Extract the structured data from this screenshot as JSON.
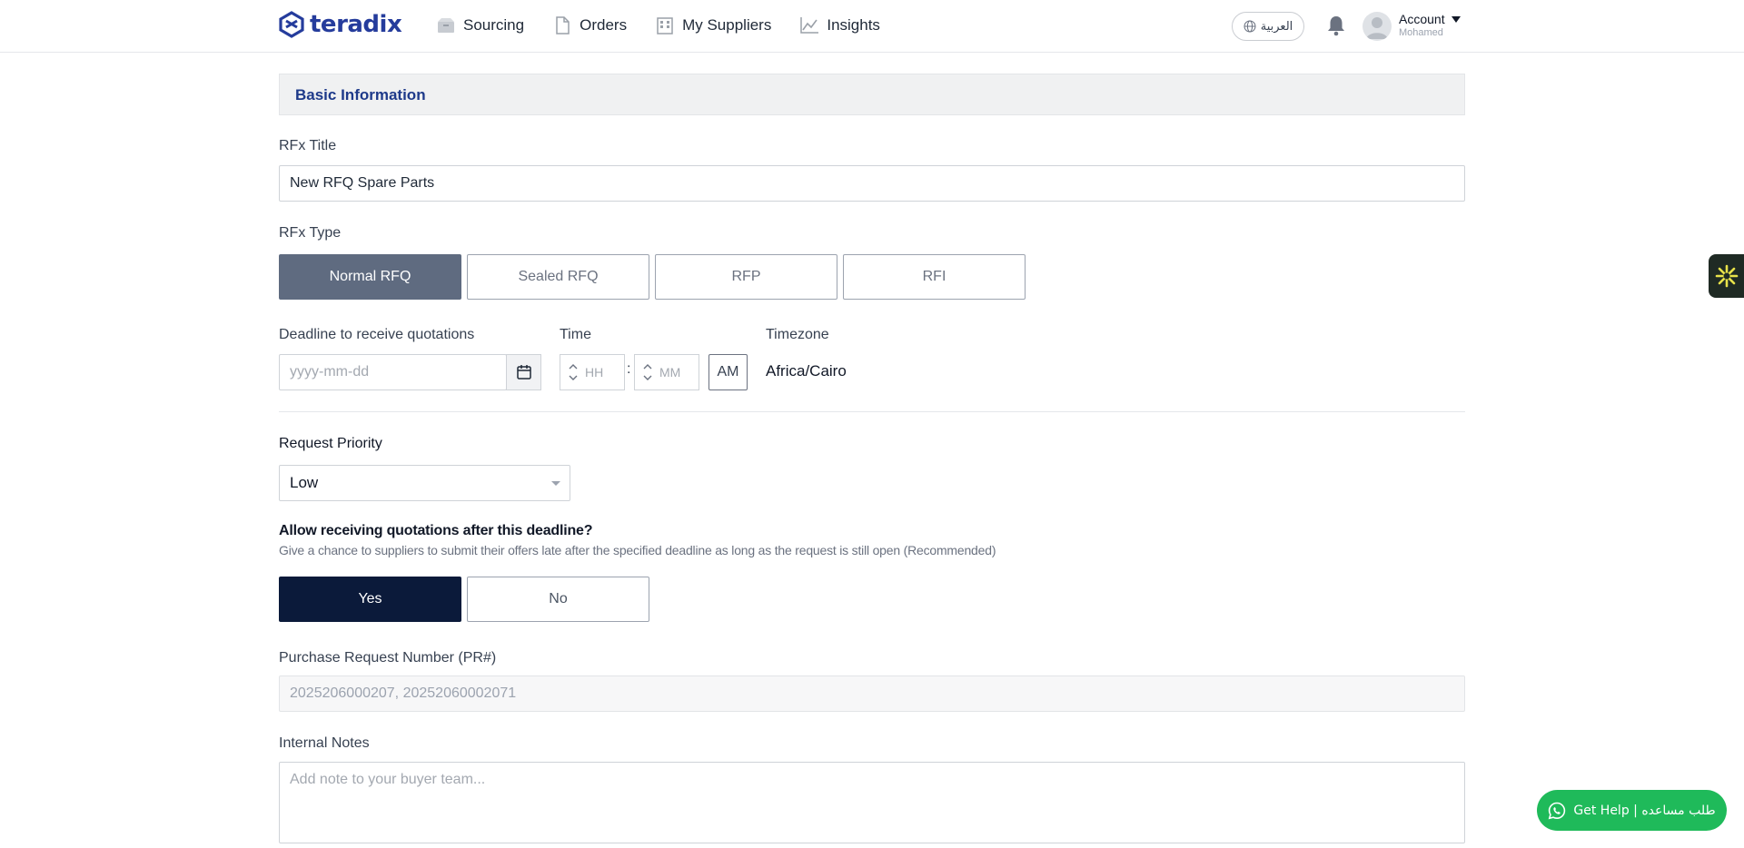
{
  "header": {
    "brand": "teradix",
    "nav": [
      {
        "label": "Sourcing",
        "icon": "box-icon"
      },
      {
        "label": "Orders",
        "icon": "document-icon"
      },
      {
        "label": "My Suppliers",
        "icon": "building-icon"
      },
      {
        "label": "Insights",
        "icon": "chart-icon"
      }
    ],
    "language": "العربية",
    "account_label": "Account",
    "account_user": "Mohamed"
  },
  "section": {
    "title": "Basic Information"
  },
  "form": {
    "rfx_title_label": "RFx Title",
    "rfx_title_value": "New RFQ Spare Parts",
    "rfx_type_label": "RFx Type",
    "rfx_types": [
      "Normal RFQ",
      "Sealed RFQ",
      "RFP",
      "RFI"
    ],
    "rfx_type_selected": "Normal RFQ",
    "deadline_label": "Deadline to receive quotations",
    "deadline_placeholder": "yyyy-mm-dd",
    "time_label": "Time",
    "hour_placeholder": "HH",
    "minute_placeholder": "MM",
    "time_separator": ":",
    "ampm": "AM",
    "timezone_label": "Timezone",
    "timezone_value": "Africa/Cairo",
    "priority_label": "Request Priority",
    "priority_value": "Low",
    "late_question": "Allow receiving quotations after this deadline?",
    "late_description": "Give a chance to suppliers to submit their offers late after the specified deadline as long as the request is still open (Recommended)",
    "late_options": [
      "Yes",
      "No"
    ],
    "late_selected": "Yes",
    "pr_label": "Purchase Request Number (PR#)",
    "pr_value": "2025206000207, 20252060002071",
    "notes_label": "Internal Notes",
    "notes_placeholder": "Add note to your buyer team..."
  },
  "help_button": "Get Help | طلب مساعده",
  "colors": {
    "brand": "#253c9c",
    "selected_type": "#5f6b80",
    "selected_yes": "#0b1a3a",
    "help": "#1fba5a"
  }
}
